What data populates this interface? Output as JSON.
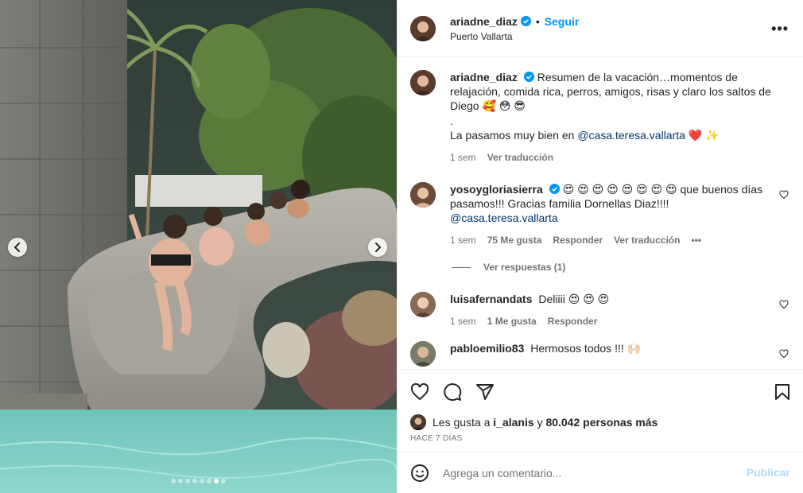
{
  "post": {
    "author": "ariadne_diaz",
    "follow_label": "Seguir",
    "separator": "•",
    "location": "Puerto Vallarta",
    "more_label": "•••",
    "caption": {
      "username": "ariadne_diaz",
      "text_line1": "Resumen de la vacación…momentos de relajación, comida rica, perros, amigos, risas y claro los saltos de Diego 🥰 😳 😎",
      "text_dot": ".",
      "text_line2_prefix": "La pasamos muy bien en ",
      "text_line2_mention": "@casa.teresa.vallarta",
      "text_line2_suffix": " ❤️ ✨",
      "time": "1 sem",
      "translate": "Ver traducción"
    },
    "comments": [
      {
        "username": "yosoygloriasierra",
        "text": "😍 😍 😍 😍 😍 😍 😍 😍 que buenos días pasamos!!! Gracias familia Dornellas Diaz!!!!",
        "mention": "@casa.teresa.vallarta",
        "time": "1 sem",
        "likes": "75 Me gusta",
        "reply": "Responder",
        "translate": "Ver traducción",
        "more": "•••",
        "view_replies": "Ver respuestas (1)"
      },
      {
        "username": "luisafernandats",
        "text": "Deliiii 😍 😍 😍",
        "time": "1 sem",
        "likes": "1 Me gusta",
        "reply": "Responder"
      },
      {
        "username": "pabloemilio83",
        "text": "Hermosos todos !!! 🙌🏻"
      }
    ],
    "likes": {
      "prefix": "Les gusta a ",
      "user": "i_alanis",
      "middle": " y ",
      "count": "80.042 personas más"
    },
    "date": "HACE 7 DÍAS",
    "comment_input": {
      "placeholder": "Agrega un comentario..."
    },
    "publish_label": "Publicar",
    "carousel": {
      "total_slides": 8,
      "active_slide": 7
    }
  },
  "colors": {
    "accent": "#0095f6",
    "mention": "#00376b",
    "secondary_text": "#737373",
    "publish_disabled": "#b3dbff",
    "border": "#efefef"
  },
  "icons": [
    "verified-icon",
    "more-icon",
    "heart-icon",
    "comment-icon",
    "share-icon",
    "bookmark-icon",
    "emoji-icon",
    "chevron-left-icon",
    "chevron-right-icon"
  ]
}
